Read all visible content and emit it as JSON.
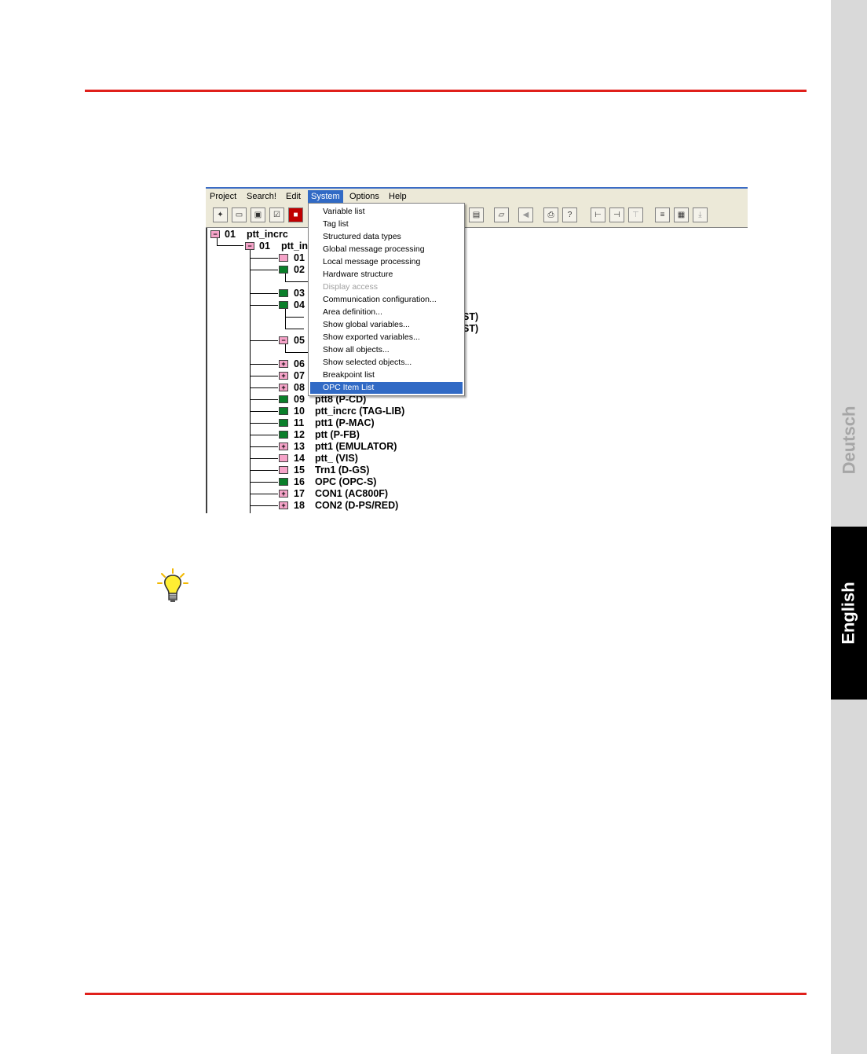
{
  "side_tabs": {
    "deutsch": "Deutsch",
    "english": "English"
  },
  "menu": [
    "Project",
    "Search!",
    "Edit",
    "System",
    "Options",
    "Help"
  ],
  "active_menu": "System",
  "system_menu": [
    {
      "label": "Variable list",
      "state": "normal"
    },
    {
      "label": "Tag list",
      "state": "normal"
    },
    {
      "label": "Structured data types",
      "state": "normal"
    },
    {
      "label": "Global message processing",
      "state": "normal"
    },
    {
      "label": "Local message processing",
      "state": "normal"
    },
    {
      "label": "Hardware structure",
      "state": "normal"
    },
    {
      "label": "Display access",
      "state": "disabled"
    },
    {
      "label": "Communication configuration...",
      "state": "normal"
    },
    {
      "label": "Area definition...",
      "state": "normal"
    },
    {
      "label": "Show global variables...",
      "state": "normal"
    },
    {
      "label": "Show exported variables...",
      "state": "normal"
    },
    {
      "label": "Show all objects...",
      "state": "normal"
    },
    {
      "label": "Show selected objects...",
      "state": "normal"
    },
    {
      "label": "Breakpoint list",
      "state": "normal"
    },
    {
      "label": "OPC Item List",
      "state": "selected"
    }
  ],
  "tree": {
    "root": {
      "num": "01",
      "label": "ptt_incrc",
      "color": "pink",
      "sign": "−"
    },
    "sub": {
      "num": "01",
      "label": "ptt_in",
      "color": "pink",
      "sign": "−"
    },
    "items": [
      {
        "num": "01",
        "label": "",
        "color": "pink",
        "sign": ""
      },
      {
        "num": "02",
        "label": "",
        "color": "green",
        "sign": ""
      },
      {
        "num": "03",
        "label": "",
        "color": "green",
        "sign": ""
      },
      {
        "num": "04",
        "label": "",
        "color": "green",
        "sign": ""
      },
      {
        "num": "05",
        "label": "",
        "color": "pink",
        "sign": "−"
      },
      {
        "num": "06",
        "label": "",
        "color": "pink",
        "sign": "+"
      },
      {
        "num": "07",
        "label": "",
        "color": "pink",
        "sign": "+"
      },
      {
        "num": "08",
        "label": "",
        "color": "pink",
        "sign": "+"
      },
      {
        "num": "09",
        "label": "ptt8  (P-CD)",
        "color": "green",
        "sign": ""
      },
      {
        "num": "10",
        "label": "ptt_incrc  (TAG-LIB)",
        "color": "green",
        "sign": ""
      },
      {
        "num": "11",
        "label": "ptt1  (P-MAC)",
        "color": "green",
        "sign": ""
      },
      {
        "num": "12",
        "label": "ptt  (P-FB)",
        "color": "green",
        "sign": ""
      },
      {
        "num": "13",
        "label": "ptt1  (EMULATOR)",
        "color": "pink",
        "sign": "+"
      },
      {
        "num": "14",
        "label": "ptt_  (VIS)",
        "color": "pink",
        "sign": ""
      },
      {
        "num": "15",
        "label": "Trn1  (D-GS)",
        "color": "pink",
        "sign": ""
      },
      {
        "num": "16",
        "label": "OPC  (OPC-S)",
        "color": "green",
        "sign": ""
      },
      {
        "num": "17",
        "label": "CON1  (AC800F)",
        "color": "pink",
        "sign": "+"
      },
      {
        "num": "18",
        "label": "CON2  (D-PS/RED)",
        "color": "pink",
        "sign": "+"
      }
    ],
    "partial_labels": {
      "row_a": "ST)",
      "row_b": "ST)"
    }
  }
}
